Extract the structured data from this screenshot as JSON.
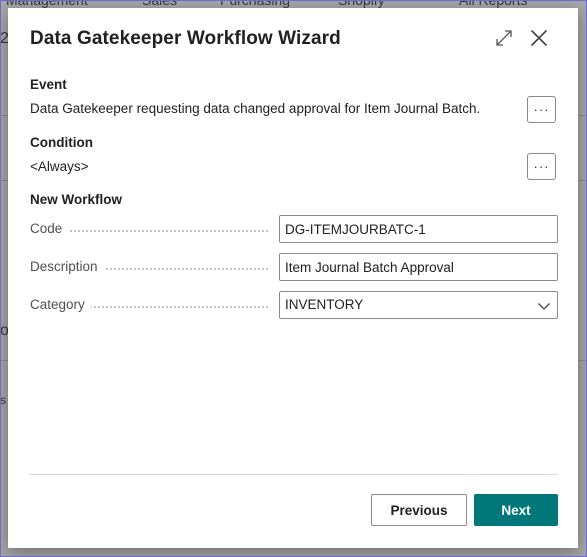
{
  "background": {
    "tabs": [
      "Management",
      "Sales",
      "Purchasing",
      "Shopify",
      "All Reports"
    ],
    "fragments": [
      "2",
      "ol",
      "s"
    ]
  },
  "dialog": {
    "title": "Data Gatekeeper Workflow Wizard",
    "expand_icon": "expand-icon",
    "close_icon": "close-icon"
  },
  "event": {
    "label": "Event",
    "value": "Data Gatekeeper requesting data changed approval for Item Journal Batch.",
    "button_label": "···"
  },
  "condition": {
    "label": "Condition",
    "value": "<Always>",
    "button_label": "···"
  },
  "new_workflow": {
    "label": "New Workflow",
    "fields": {
      "code": {
        "label": "Code",
        "value": "DG-ITEMJOURBATC-1"
      },
      "description": {
        "label": "Description",
        "value": "Item Journal Batch Approval"
      },
      "category": {
        "label": "Category",
        "value": "INVENTORY"
      }
    }
  },
  "footer": {
    "previous_label": "Previous",
    "next_label": "Next"
  },
  "colors": {
    "accent": "#00787a",
    "overlay": "#a7a7a7",
    "frame_border": "#6b6bd6"
  }
}
